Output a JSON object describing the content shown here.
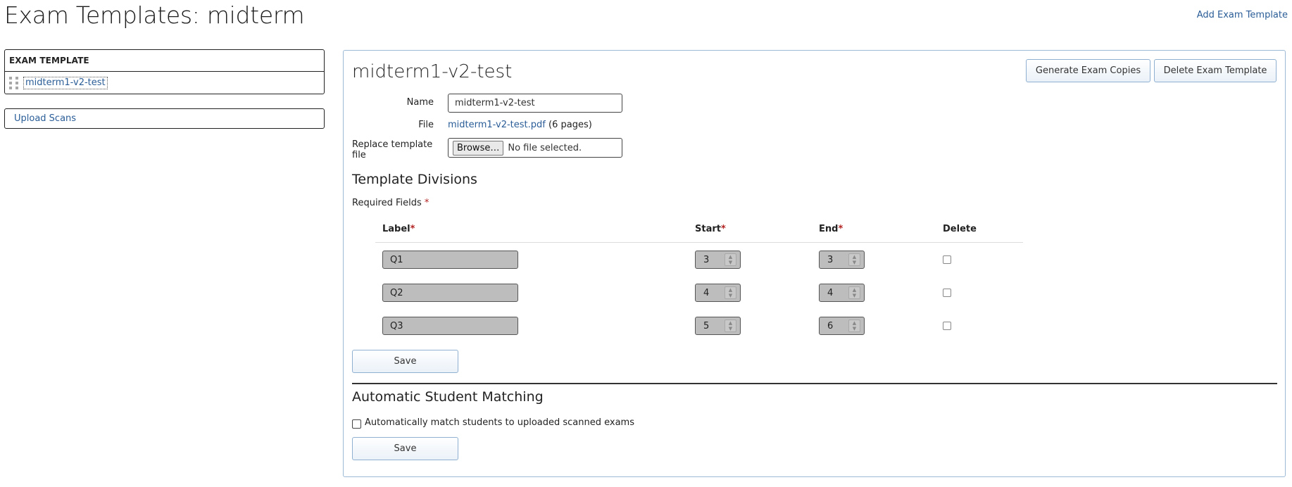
{
  "header": {
    "title": "Exam Templates: midterm",
    "add_link": "Add Exam Template"
  },
  "sidebar": {
    "table_header": "EXAM TEMPLATE",
    "templates": [
      "midterm1-v2-test"
    ],
    "upload_link": "Upload Scans"
  },
  "detail": {
    "title": "midterm1-v2-test",
    "generate_button": "Generate Exam Copies",
    "delete_button": "Delete Exam Template",
    "name_label": "Name",
    "name_value": "midterm1-v2-test",
    "file_label": "File",
    "file_link": "midterm1-v2-test.pdf",
    "file_pages": "(6 pages)",
    "replace_label": "Replace template file",
    "browse_button": "Browse…",
    "no_file_text": "No file selected."
  },
  "divisions": {
    "title": "Template Divisions",
    "required_note": "Required Fields",
    "required_marker": "*",
    "columns": {
      "label": "Label",
      "start": "Start",
      "end": "End",
      "delete": "Delete"
    },
    "rows": [
      {
        "label": "Q1",
        "start": "3",
        "end": "3"
      },
      {
        "label": "Q2",
        "start": "4",
        "end": "4"
      },
      {
        "label": "Q3",
        "start": "5",
        "end": "6"
      }
    ],
    "save_button": "Save"
  },
  "matching": {
    "title": "Automatic Student Matching",
    "checkbox_label": "Automatically match students to uploaded scanned exams",
    "save_button": "Save"
  }
}
